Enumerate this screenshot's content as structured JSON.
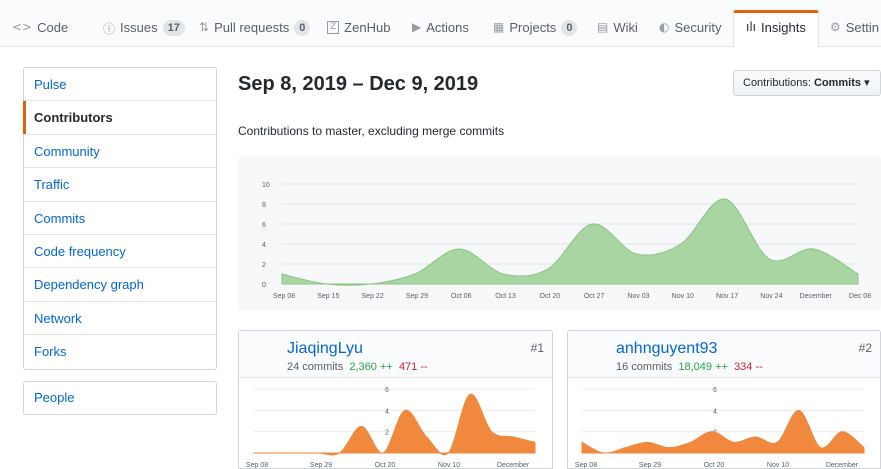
{
  "tabs": [
    {
      "icon": "<>",
      "label": "Code"
    },
    {
      "icon": "ⓘ",
      "label": "Issues",
      "count": "17"
    },
    {
      "icon": "⇅",
      "label": "Pull requests",
      "count": "0"
    },
    {
      "icon": "Z",
      "label": "ZenHub"
    },
    {
      "icon": "▶",
      "label": "Actions"
    },
    {
      "icon": "▦",
      "label": "Projects",
      "count": "0"
    },
    {
      "icon": "▤",
      "label": "Wiki"
    },
    {
      "icon": "◐",
      "label": "Security"
    },
    {
      "icon": "ılı",
      "label": "Insights"
    },
    {
      "icon": "⚙",
      "label": "Settin"
    }
  ],
  "sidebar": {
    "items": [
      {
        "label": "Pulse"
      },
      {
        "label": "Contributors"
      },
      {
        "label": "Community"
      },
      {
        "label": "Traffic"
      },
      {
        "label": "Commits"
      },
      {
        "label": "Code frequency"
      },
      {
        "label": "Dependency graph"
      },
      {
        "label": "Network"
      },
      {
        "label": "Forks"
      }
    ],
    "people": "People"
  },
  "header": {
    "date_range": "Sep 8, 2019 – Dec 9, 2019",
    "dropdown_prefix": "Contributions: ",
    "dropdown_value": "Commits",
    "dropdown_caret": "▾",
    "subtitle": "Contributions to master, excluding merge commits"
  },
  "colors": {
    "accent_tab": "#e36209",
    "main_area": "#a8d5a2",
    "main_line": "#8cc386",
    "contributor_area": "#f0883e",
    "link": "#0366d6",
    "additions": "#28a745",
    "deletions": "#cb2431"
  },
  "chart_data": [
    {
      "type": "area",
      "ylim": [
        0,
        10
      ],
      "yticks": [
        "0",
        "2",
        "4",
        "6",
        "8",
        "10"
      ],
      "x_tick_labels": [
        "Sep 08",
        "Sep 15",
        "Sep 22",
        "Sep 29",
        "Oct 06",
        "Oct 13",
        "Oct 20",
        "Oct 27",
        "Nov 03",
        "Nov 10",
        "Nov 17",
        "Nov 24",
        "December",
        "Dec 08"
      ],
      "series": [
        {
          "values": [
            1,
            0,
            0,
            1,
            3.5,
            1,
            1.5,
            6,
            3,
            4,
            8.5,
            2.5,
            3.5,
            1
          ]
        }
      ]
    },
    {
      "type": "area",
      "ylim": [
        0,
        6
      ],
      "yticks": [
        "2",
        "4",
        "6"
      ],
      "x_tick_labels": [
        "Sep 08",
        "Sep 29",
        "Oct 20",
        "Nov 10",
        "December"
      ],
      "series": [
        {
          "values": [
            0,
            0,
            0,
            0,
            0,
            2.5,
            0,
            4,
            1.5,
            0,
            5.5,
            2,
            1.5,
            1
          ]
        }
      ]
    },
    {
      "type": "area",
      "ylim": [
        0,
        6
      ],
      "yticks": [
        "2",
        "4",
        "6"
      ],
      "x_tick_labels": [
        "Sep 08",
        "Sep 29",
        "Oct 20",
        "Nov 10",
        "December"
      ],
      "series": [
        {
          "values": [
            1,
            0,
            0.5,
            1,
            0.5,
            1,
            2,
            1,
            1.5,
            1,
            4,
            0.5,
            2,
            0.5
          ]
        }
      ]
    }
  ],
  "contributors": [
    {
      "name": "JiaqingLyu",
      "commits": "24 commits",
      "additions": "2,360 ++",
      "deletions": "471 --",
      "rank": "#1"
    },
    {
      "name": "anhnguyent93",
      "commits": "16 commits",
      "additions": "18,049 ++",
      "deletions": "334 --",
      "rank": "#2"
    }
  ]
}
